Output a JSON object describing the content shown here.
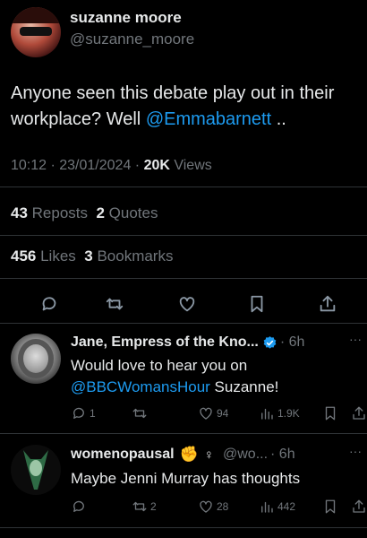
{
  "colors": {
    "accent": "#1d9bf0",
    "muted": "#71767b",
    "text": "#e7e9ea",
    "background": "#000000",
    "divider": "#2f3336"
  },
  "main_tweet": {
    "display_name": "suzanne moore",
    "handle": "@suzanne_moore",
    "text_before": "Anyone seen this debate play out in their workplace?  Well ",
    "mention": "@Emmabarnett",
    "text_after": " ..",
    "time": "10:12 · 23/01/2024 · ",
    "views_count": "20K",
    "views_label": " Views",
    "reposts_count": "43",
    "reposts_label": " Reposts",
    "quotes_count": "2",
    "quotes_label": " Quotes",
    "likes_count": "456",
    "likes_label": " Likes",
    "bookmarks_count": "3",
    "bookmarks_label": " Bookmarks",
    "action_icons": [
      "reply-icon",
      "repost-icon",
      "like-icon",
      "bookmark-icon",
      "share-icon"
    ]
  },
  "replies": [
    {
      "display_name": "Jane, Empress of the Kno...",
      "verified": true,
      "time": "· 6h",
      "more": "···",
      "text_line1": "Would love to hear you on",
      "mention": "@BBCWomansHour",
      "text_after": " Suzanne!",
      "reply_count": "1",
      "repost_count": "",
      "like_count": "94",
      "views_count": "1.9K"
    },
    {
      "display_name": "womenopausal",
      "emoji": "✊",
      "female_sign": "♀",
      "handle": "@wo...",
      "time": "· 6h",
      "more": "···",
      "text": "Maybe Jenni Murray has thoughts",
      "reply_count": "",
      "repost_count": "2",
      "like_count": "28",
      "views_count": "442"
    }
  ]
}
